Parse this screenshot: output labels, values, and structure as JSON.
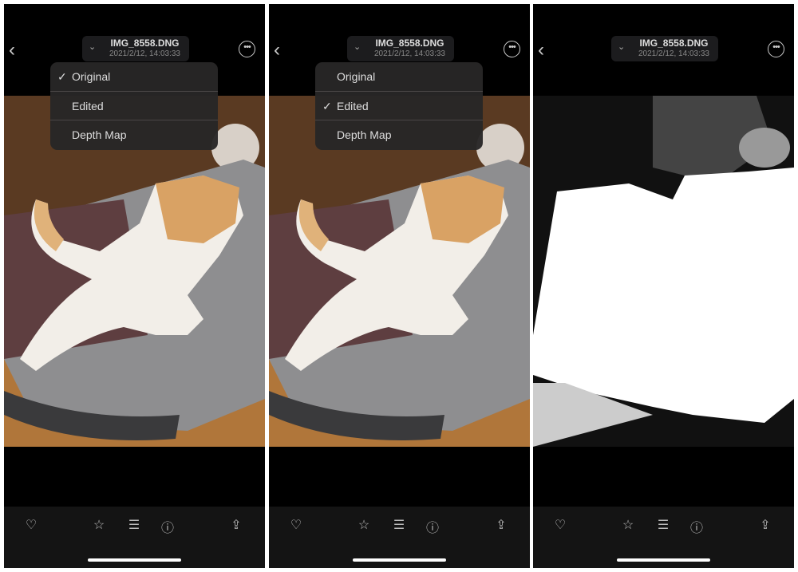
{
  "panels": [
    {
      "file_name": "IMG_8558.DNG",
      "date": "2021/2/12, 14:03:33",
      "menu": {
        "visible": true,
        "selected": "Original",
        "items": [
          "Original",
          "Edited",
          "Depth Map"
        ]
      },
      "view": "original"
    },
    {
      "file_name": "IMG_8558.DNG",
      "date": "2021/2/12, 14:03:33",
      "menu": {
        "visible": true,
        "selected": "Edited",
        "items": [
          "Original",
          "Edited",
          "Depth Map"
        ]
      },
      "view": "edited"
    },
    {
      "file_name": "IMG_8558.DNG",
      "date": "2021/2/12, 14:03:33",
      "menu": {
        "visible": false
      },
      "view": "depth-map"
    }
  ],
  "icons": {
    "back": "chevron-left-icon",
    "title_dropdown": "chevron-down-icon",
    "more": "ellipsis-circle-icon",
    "toolbar": [
      "heart-icon",
      "star-icon",
      "sliders-icon",
      "info-icon",
      "share-icon"
    ]
  },
  "glyphs": {
    "back": "‹",
    "chev": "⌄",
    "more": "•••",
    "check": "✓",
    "heart": "♡",
    "star": "☆",
    "sliders": "☰",
    "info": "ⓘ",
    "share": "⇪"
  }
}
